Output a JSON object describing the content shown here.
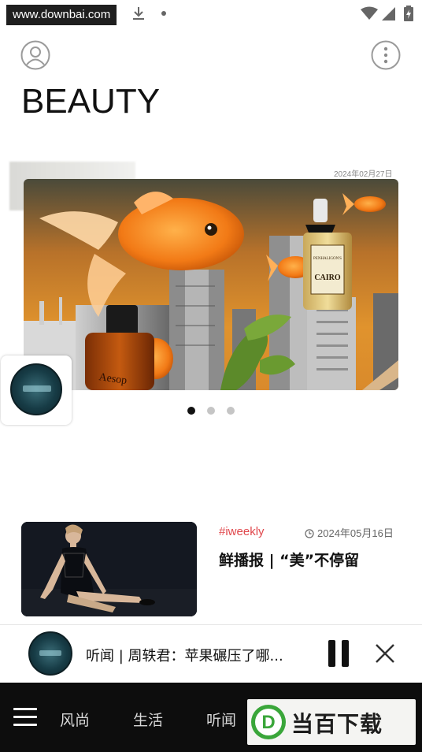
{
  "status_bar": {
    "watermark": "www.downbai.com",
    "icons": [
      "download-icon",
      "notification-dot-icon",
      "wifi-icon",
      "signal-icon",
      "battery-icon"
    ]
  },
  "header": {
    "title": "BEAUTY",
    "left_icon": "user-avatar-icon",
    "right_icon": "more-vertical-icon"
  },
  "hero": {
    "date": "2024年02月27日",
    "carousel": {
      "count": 3,
      "active_index": 0
    },
    "bottle_labels": {
      "left": "Aesop",
      "right_brand": "PENHALIGON'S",
      "right_name": "CAIRO"
    }
  },
  "article": {
    "tag": "#iweekly",
    "date": "2024年05月16日",
    "title": "鲜播报 | “美”不停留"
  },
  "player": {
    "title": "听闻 | 周轶君：苹果碾压了哪...",
    "state": "playing"
  },
  "bottom_nav": {
    "items": [
      {
        "label": "风尚"
      },
      {
        "label": "生活"
      },
      {
        "label": "听闻"
      }
    ]
  },
  "brand_badge": {
    "logo_letter": "D",
    "text": "当百下载"
  },
  "colors": {
    "accent_tag": "#e0474c",
    "nav_background": "#0d0d0d",
    "hero_sky": "#d98a2c",
    "brand_green": "#3aa63a"
  }
}
